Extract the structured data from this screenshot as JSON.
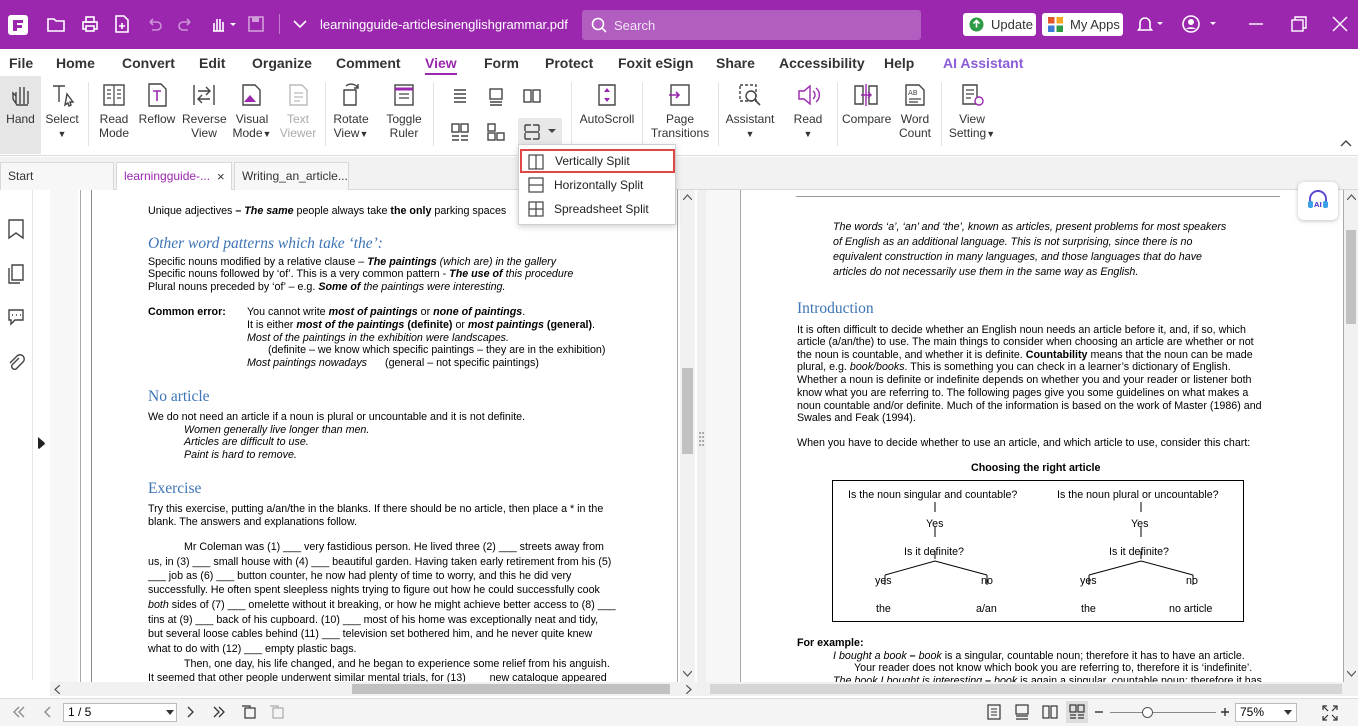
{
  "titlebar": {
    "filename": "learningguide-articlesinenglishgrammar.pdf",
    "search_placeholder": "Search",
    "update_label": "Update",
    "myapps_label": "My Apps"
  },
  "menu": {
    "items": [
      "File",
      "Home",
      "Convert",
      "Edit",
      "Organize",
      "Comment",
      "View",
      "Form",
      "Protect",
      "Foxit eSign",
      "Share",
      "Accessibility",
      "Help",
      "AI Assistant"
    ],
    "active": "View"
  },
  "ribbon": {
    "hand": "Hand",
    "select": "Select",
    "read_mode": [
      "Read",
      "Mode"
    ],
    "reflow": "Reflow",
    "reverse_view": [
      "Reverse",
      "View"
    ],
    "visual_mode": [
      "Visual",
      "Mode"
    ],
    "text_viewer": [
      "Text",
      "Viewer"
    ],
    "rotate_view": [
      "Rotate",
      "View"
    ],
    "toggle_ruler": [
      "Toggle",
      "Ruler"
    ],
    "autoscroll": "AutoScroll",
    "page_transitions": [
      "Page",
      "Transitions"
    ],
    "assistant": "Assistant",
    "read": "Read",
    "compare": "Compare",
    "word_count": [
      "Word",
      "Count"
    ],
    "view_setting": [
      "View",
      "Setting"
    ]
  },
  "tabs": {
    "start": "Start",
    "doc1": "learningguide-...",
    "doc2": "Writing_an_article..."
  },
  "split_menu": {
    "items": [
      "Vertically Split",
      "Horizontally Split",
      "Spreadsheet Split"
    ],
    "highlighted": "Vertically Split"
  },
  "left_page": {
    "l1a": "Unique adjectives",
    "l1b": " – ",
    "l1c": "The same",
    "l1d": " people always take ",
    "l1e": "the only",
    "l1f": " parking spaces",
    "h1": "Other word patterns which take ‘the’:",
    "p1a": "Specific nouns modified by a relative clause – ",
    "p1b": "The paintings",
    "p1c": " (which are) in the gallery",
    "p2a": "Specific nouns followed by ‘of’. This is a very common pattern - ",
    "p2b": "The use of",
    "p2c": " this procedure",
    "p3a": "Plural nouns preceded by ‘of’ – e.g. ",
    "p3b": "Some of",
    "p3c": " the paintings were interesting.",
    "ce_label": "Common error:",
    "ce1a": "You cannot write ",
    "ce1b": "most of paintings",
    "ce1c": " or ",
    "ce1d": "none of paintings",
    "ce1e": ".",
    "ce2a": "It is either ",
    "ce2b": "most of the paintings",
    "ce2c": " (definite)",
    "ce2d": " or ",
    "ce2e": "most paintings",
    "ce2f": " (general)",
    "ce2g": ".",
    "ce3": "Most of the paintings in the exhibition were landscapes.",
    "ce4": "(definite – we know which specific paintings – they are in the exhibition)",
    "ce5a": "Most paintings nowadays",
    "ce5b": "(general – not specific paintings)",
    "h2": "No article",
    "na1": "We do not need an article if a noun is plural or uncountable and it is not definite.",
    "na2": "Women generally live longer than men.",
    "na3": "Articles are difficult to use.",
    "na4": "Paint is hard to remove.",
    "h3": "Exercise",
    "ex1": "Try this exercise, putting a/an/the in the blanks. If there should be no article, then place a * in the",
    "ex2": "blank. The answers and explanations follow.",
    "e1": "Mr Coleman was (1) ___ very fastidious person. He lived three (2) ___ streets away from",
    "e2": "us, in (3) ___ small house with (4) ___ beautiful garden. Having taken early retirement from his (5)",
    "e3": "___ job as (6) ___ button counter, he now had plenty of time to worry, and this he did very",
    "e4": "successfully. He often spent sleepless nights trying to figure out how he could successfully cook",
    "e5a": "both",
    "e5b": " sides of (7) ___ omelette without it breaking, or how he might achieve better access to (8) ___",
    "e6": "tins at (9) ___ back of his cupboard. (10) ___ most of his home was exceptionally neat and tidy,",
    "e7": "but several loose cables behind (11) ___ television set bothered him, and he never quite knew",
    "e8": "what to do with (12) ___ empty plastic bags.",
    "e9": "Then, one day, his life changed, and he began to experience some relief from his anguish.",
    "e10": "It seemed that other people underwent similar mental trials, for (13) ___ new catalogue appeared"
  },
  "right_page": {
    "i1": "The words ‘a’, ‘an’ and ‘the’, known as articles, present problems for most speakers",
    "i2": "of English as an additional language. This is not surprising, since there is no",
    "i3": "equivalent construction in many languages, and those languages that do have",
    "i4": "articles do not necessarily use them in the same way as English.",
    "h1": "Introduction",
    "p1": "It is often difficult to decide whether an English noun needs an article before it, and, if so, which",
    "p2": "article (a/an/the) to use. The main things to consider when choosing an article are whether or not",
    "p3a": "the noun is countable, and whether it is definite. ",
    "p3b": "Countability",
    "p3c": " means that the noun can be made",
    "p4a": "plural, e.g. ",
    "p4b": "book/books",
    "p4c": ". This is something you can check in a learner’s dictionary of English.",
    "p5": "Whether a noun is definite or indefinite depends on whether you and your reader or listener both",
    "p6": "know what you are referring to. The following pages give you some guidelines on what makes a",
    "p7": "noun countable and/or definite. Much of the information is based on the work of Master (1986) and",
    "p8": "Swales and Feak (1994).",
    "p9": "When you have to decide whether to use an article, and which article to use, consider this chart:",
    "chart_title": "Choosing the right article",
    "q1": "Is the noun singular and countable?",
    "q2": "Is the noun plural or uncountable?",
    "yes": "Yes",
    "def": "Is it definite?",
    "y": "yes",
    "n": "no",
    "the": "the",
    "aan": "a/an",
    "noart": "no article",
    "fe": "For example:",
    "fe1a": "I bought a book",
    "fe1b": " – ",
    "fe1c": "book",
    "fe1d": " is a singular, countable noun; therefore it has to have an article.",
    "fe2": "Your reader does not know which book you are referring to, therefore it is ‘indefinite’.",
    "fe3a": "The book I bought is interesting",
    "fe3b": " – ",
    "fe3c": "book",
    "fe3d": " is again a singular, countable noun; therefore it has"
  },
  "status": {
    "page": "1 / 5",
    "zoom": "75%"
  }
}
